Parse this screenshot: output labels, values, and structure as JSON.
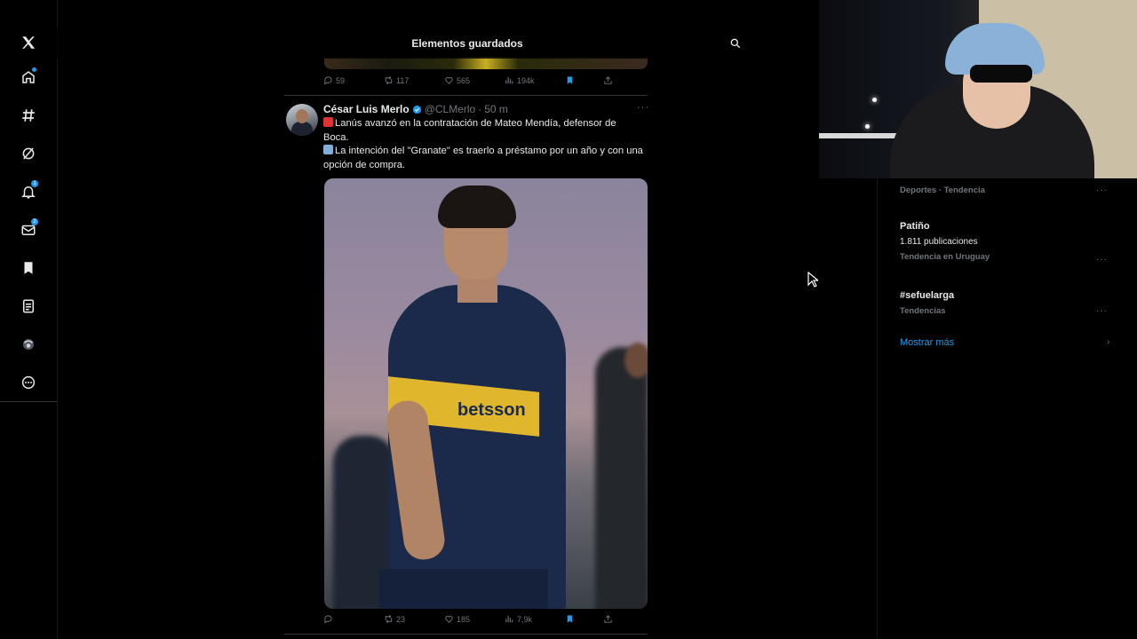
{
  "header": {
    "title": "Elementos guardados"
  },
  "sidebar": {
    "items": [
      {
        "icon": "x-logo-icon"
      },
      {
        "icon": "home-icon"
      },
      {
        "icon": "explore-icon"
      },
      {
        "icon": "grok-icon"
      },
      {
        "icon": "notifications-icon",
        "badge": "1"
      },
      {
        "icon": "messages-icon",
        "badge": "2"
      },
      {
        "icon": "bookmarks-icon"
      },
      {
        "icon": "lists-icon"
      },
      {
        "icon": "profile-icon"
      },
      {
        "icon": "more-icon"
      }
    ]
  },
  "prev_tweet": {
    "actions": {
      "replies": "59",
      "reposts": "117",
      "likes": "565",
      "views": "194k"
    }
  },
  "tweet": {
    "author_name": "César Luis Merlo",
    "handle": "@CLMerlo",
    "separator": "·",
    "time": "50 m",
    "line1": "Lanús avanzó en la contratación de Mateo Mendía, defensor de Boca.",
    "line2": "La intención del \"Granate\" es traerlo a préstamo por un año y con una opción de compra.",
    "photo_sponsor": "betsson",
    "actions": {
      "replies": "",
      "reposts": "23",
      "likes": "185",
      "views": "7,9k"
    }
  },
  "trends": [
    {
      "title": "",
      "sub": "",
      "meta": "Deportes · Tendencia"
    },
    {
      "title": "Patiño",
      "sub": "1.811 publicaciones",
      "meta": "Tendencia en Uruguay"
    },
    {
      "title": "#sefuelarga",
      "sub": "",
      "meta": "Tendencias"
    }
  ],
  "show_more": "Mostrar más",
  "colors": {
    "accent": "#1d9bf0",
    "muted": "#71767b",
    "text": "#e7e9ea",
    "background": "#000000"
  }
}
